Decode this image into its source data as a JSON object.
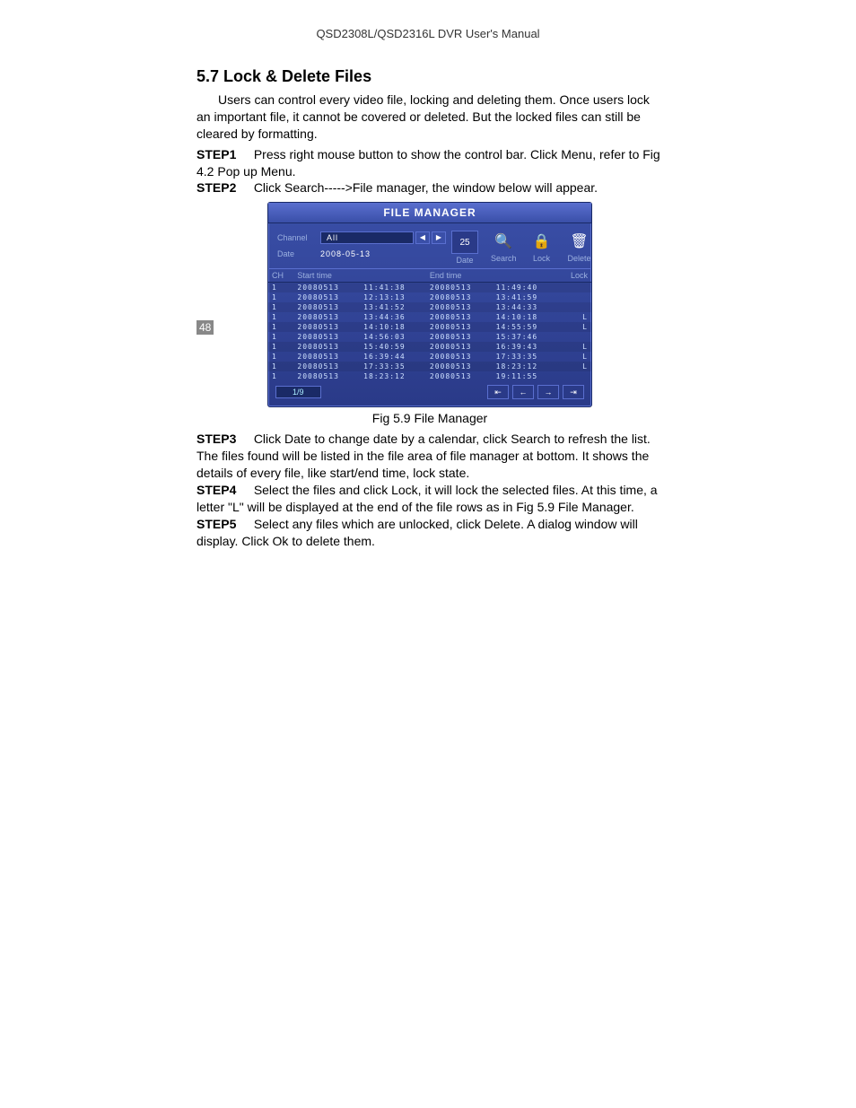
{
  "header": "QSD2308L/QSD2316L DVR User's Manual",
  "section_title": "5.7 Lock & Delete Files",
  "intro": "Users can control every video file, locking and deleting them. Once users lock an important file, it cannot be covered or deleted. But the locked files can still be cleared by formatting.",
  "steps": {
    "s1_label": "STEP1",
    "s1_text": "Press right mouse button to show the control bar. Click Menu, refer to Fig 4.2 Pop up Menu.",
    "s2_label": "STEP2",
    "s2_text": "Click Search----->File manager, the window below will appear.",
    "s3_label": "STEP3",
    "s3_text": "Click Date to change date by a calendar, click Search to refresh the list. The files found will be listed in the file area of file manager at bottom. It shows the details of every file, like start/end time, lock state.",
    "s4_label": "STEP4",
    "s4_text": "Select the files and click Lock, it will lock the selected files. At this time, a letter \"L\" will be displayed at the end of the file rows as in Fig 5.9 File Manager.",
    "s5_label": "STEP5",
    "s5_text": "Select any files which are unlocked, click Delete. A dialog window will display. Click Ok to delete them."
  },
  "figure_caption": "Fig 5.9 File Manager",
  "page_number": "48",
  "fm": {
    "title": "FILE MANAGER",
    "channel_label": "Channel",
    "channel_value": "All",
    "date_label": "Date",
    "date_value": "2008-05-13",
    "icons": {
      "date_val": "25",
      "date": "Date",
      "search": "Search",
      "lock": "Lock",
      "delete": "Delete"
    },
    "cols": {
      "ch": "CH",
      "start": "Start time",
      "end": "End time",
      "lock": "Lock"
    },
    "rows": [
      {
        "ch": "1",
        "sd": "20080513",
        "st": "11:41:38",
        "ed": "20080513",
        "et": "11:49:40",
        "l": ""
      },
      {
        "ch": "1",
        "sd": "20080513",
        "st": "12:13:13",
        "ed": "20080513",
        "et": "13:41:59",
        "l": ""
      },
      {
        "ch": "1",
        "sd": "20080513",
        "st": "13:41:52",
        "ed": "20080513",
        "et": "13:44:33",
        "l": ""
      },
      {
        "ch": "1",
        "sd": "20080513",
        "st": "13:44:36",
        "ed": "20080513",
        "et": "14:10:18",
        "l": "L"
      },
      {
        "ch": "1",
        "sd": "20080513",
        "st": "14:10:18",
        "ed": "20080513",
        "et": "14:55:59",
        "l": "L"
      },
      {
        "ch": "1",
        "sd": "20080513",
        "st": "14:56:03",
        "ed": "20080513",
        "et": "15:37:46",
        "l": ""
      },
      {
        "ch": "1",
        "sd": "20080513",
        "st": "15:40:59",
        "ed": "20080513",
        "et": "16:39:43",
        "l": "L"
      },
      {
        "ch": "1",
        "sd": "20080513",
        "st": "16:39:44",
        "ed": "20080513",
        "et": "17:33:35",
        "l": "L"
      },
      {
        "ch": "1",
        "sd": "20080513",
        "st": "17:33:35",
        "ed": "20080513",
        "et": "18:23:12",
        "l": "L"
      },
      {
        "ch": "1",
        "sd": "20080513",
        "st": "18:23:12",
        "ed": "20080513",
        "et": "19:11:55",
        "l": ""
      }
    ],
    "page_indicator": "1/9"
  }
}
